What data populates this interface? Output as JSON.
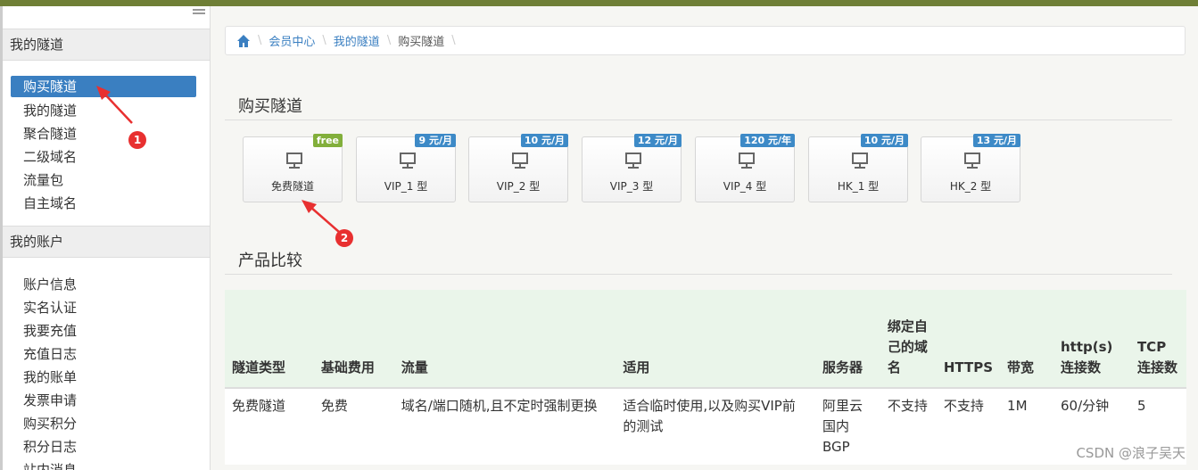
{
  "sidebar": {
    "section1_title": "我的隧道",
    "section1_items": [
      "购买隧道",
      "我的隧道",
      "聚合隧道",
      "二级域名",
      "流量包",
      "自主域名"
    ],
    "section2_title": "我的账户",
    "section2_items": [
      "账户信息",
      "实名认证",
      "我要充值",
      "充值日志",
      "我的账单",
      "发票申请",
      "购买积分",
      "积分日志",
      "站内消息"
    ]
  },
  "breadcrumb": {
    "items": [
      "会员中心",
      "我的隧道",
      "购买隧道"
    ]
  },
  "buy": {
    "title": "购买隧道",
    "plans": [
      {
        "badge": "free",
        "label": "免费隧道"
      },
      {
        "badge": "9 元/月",
        "label": "VIP_1 型"
      },
      {
        "badge": "10 元/月",
        "label": "VIP_2 型"
      },
      {
        "badge": "12 元/月",
        "label": "VIP_3 型"
      },
      {
        "badge": "120 元/年",
        "label": "VIP_4 型"
      },
      {
        "badge": "10 元/月",
        "label": "HK_1 型"
      },
      {
        "badge": "13 元/月",
        "label": "HK_2 型"
      }
    ]
  },
  "compare": {
    "title": "产品比较",
    "headers": [
      "隧道类型",
      "基础费用",
      "流量",
      "适用",
      "服务器",
      "绑定自己的域名",
      "HTTPS",
      "带宽",
      "http(s)连接数",
      "TCP连接数"
    ],
    "rows": [
      [
        "免费隧道",
        "免费",
        "域名/端口随机,且不定时强制更换",
        "适合临时使用,以及购买VIP前的测试",
        "阿里云国内BGP",
        "不支持",
        "不支持",
        "1M",
        "60/分钟",
        "5"
      ]
    ]
  },
  "annotations": [
    "1",
    "2"
  ],
  "watermark": "CSDN @浪子吴天",
  "colors": {
    "accent": "#3a7fc1",
    "topbar": "#6f7f36",
    "free_badge": "#82af3b",
    "price_badge": "#3d8ac7",
    "annotation": "#e83030"
  }
}
